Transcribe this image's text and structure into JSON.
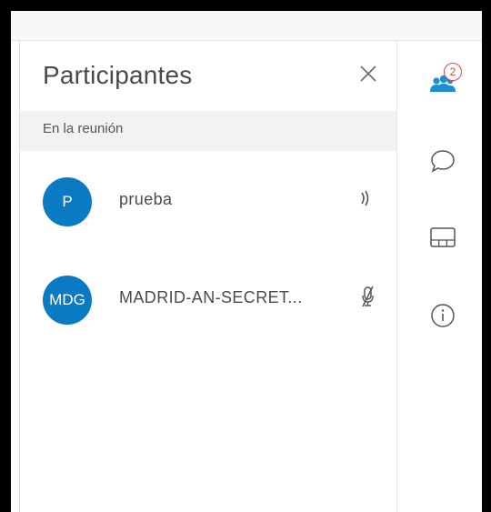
{
  "panel": {
    "title": "Participantes",
    "section_label": "En la reunión"
  },
  "participants": [
    {
      "initials": "P",
      "name": "prueba",
      "status_icon": "speaker-active-icon"
    },
    {
      "initials": "MDG",
      "name": "MADRID-AN-SECRET...",
      "status_icon": "microphone-muted-icon"
    }
  ],
  "rail": {
    "participants_badge": "2",
    "icons": [
      "participants-icon",
      "chat-icon",
      "layout-icon",
      "info-icon"
    ]
  },
  "colors": {
    "avatar": "#0a7bc2",
    "accent": "#1a8fd6",
    "badge": "#e0453a"
  }
}
